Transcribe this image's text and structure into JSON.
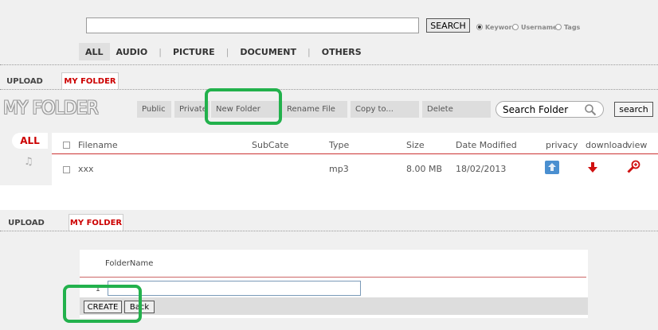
{
  "search": {
    "button_label": "SEARCH",
    "input_value": ""
  },
  "search_options": [
    {
      "label": "Keyword",
      "checked": true
    },
    {
      "label": "Username",
      "checked": false
    },
    {
      "label": "Tags",
      "checked": false
    }
  ],
  "categories": [
    "ALL",
    "AUDIO",
    "PICTURE",
    "DOCUMENT",
    "OTHERS"
  ],
  "subtabs": {
    "upload": "UPLOAD",
    "my_folder": "MY FOLDER"
  },
  "folder": {
    "title": "MY FOLDER",
    "toolbar": {
      "public": "Public",
      "private": "Private",
      "new_folder": "New Folder",
      "rename_file": "Rename File",
      "copy_to": "Copy to...",
      "delete": "Delete"
    },
    "search_placeholder": "Search Folder",
    "search_button": "search",
    "filter_tab": "ALL",
    "columns": {
      "filename": "Filename",
      "subcate": "SubCate",
      "type": "Type",
      "size": "Size",
      "date_modified": "Date Modified",
      "privacy": "privacy",
      "download": "download",
      "view": "view"
    },
    "rows": [
      {
        "filename": "xxx",
        "subcate": "",
        "type": "mp3",
        "size": "8.00 MB",
        "date_modified": "18/02/2013"
      }
    ]
  },
  "create_form": {
    "label": "FolderName",
    "row_number": "1",
    "input_value": "",
    "create_button": "CREATE",
    "back_button": "Back"
  },
  "colors": {
    "accent_red": "#cc0000",
    "highlight_green": "#22b14c",
    "panel_gray": "#f0f0f0"
  }
}
